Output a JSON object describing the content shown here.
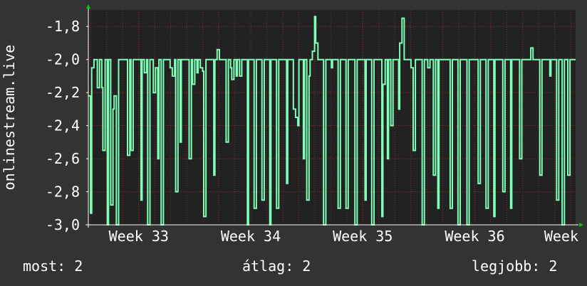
{
  "chart_data": {
    "type": "line",
    "ylabel": "onlinestream.live",
    "ylim": [
      -3.0,
      -1.7
    ],
    "yticks": [
      -3.0,
      -2.8,
      -2.6,
      -2.4,
      -2.2,
      -2.0,
      -1.8
    ],
    "ytick_labels": [
      "-3,0",
      "-2,8",
      "-2,6",
      "-2,4",
      "-2,2",
      "-2,0",
      "-1,8"
    ],
    "xlim": [
      32.55,
      36.9
    ],
    "xticks": [
      33,
      34,
      35,
      36,
      37
    ],
    "xtick_labels": [
      "Week 33",
      "Week 34",
      "Week 35",
      "Week 36",
      "Week"
    ],
    "grid": true,
    "colors": {
      "background": "#333333",
      "plot": "#222222",
      "grid": "#8b2a2a",
      "line": "#7effb7",
      "axis": "#ffffff",
      "arrow": "#00cc00"
    },
    "series": [
      {
        "values": [
          [
            32.55,
            -2.22
          ],
          [
            32.57,
            -2.93
          ],
          [
            32.58,
            -2.05
          ],
          [
            32.6,
            -2.0
          ],
          [
            32.62,
            -2.0
          ],
          [
            32.63,
            -2.17
          ],
          [
            32.65,
            -2.0
          ],
          [
            32.67,
            -2.17
          ],
          [
            32.68,
            -2.55
          ],
          [
            32.7,
            -2.0
          ],
          [
            32.72,
            -3.0
          ],
          [
            32.73,
            -2.0
          ],
          [
            32.75,
            -2.88
          ],
          [
            32.77,
            -2.3
          ],
          [
            32.78,
            -2.22
          ],
          [
            32.8,
            -3.0
          ],
          [
            32.82,
            -2.0
          ],
          [
            32.83,
            -2.0
          ],
          [
            32.85,
            -2.0
          ],
          [
            32.87,
            -2.0
          ],
          [
            32.88,
            -2.0
          ],
          [
            32.9,
            -2.58
          ],
          [
            32.92,
            -2.0
          ],
          [
            32.93,
            -2.55
          ],
          [
            32.95,
            -2.0
          ],
          [
            32.97,
            -2.0
          ],
          [
            32.98,
            -2.0
          ],
          [
            33.0,
            -2.0
          ],
          [
            33.02,
            -2.85
          ],
          [
            33.03,
            -2.0
          ],
          [
            33.05,
            -2.08
          ],
          [
            33.07,
            -2.0
          ],
          [
            33.08,
            -3.0
          ],
          [
            33.1,
            -2.0
          ],
          [
            33.12,
            -2.0
          ],
          [
            33.13,
            -2.2
          ],
          [
            33.15,
            -2.05
          ],
          [
            33.17,
            -2.6
          ],
          [
            33.18,
            -2.0
          ],
          [
            33.2,
            -3.0
          ],
          [
            33.22,
            -2.0
          ],
          [
            33.23,
            -2.0
          ],
          [
            33.25,
            -2.0
          ],
          [
            33.27,
            -2.0
          ],
          [
            33.28,
            -2.05
          ],
          [
            33.3,
            -2.1
          ],
          [
            33.32,
            -2.0
          ],
          [
            33.33,
            -2.8
          ],
          [
            33.35,
            -2.0
          ],
          [
            33.37,
            -2.5
          ],
          [
            33.38,
            -2.0
          ],
          [
            33.4,
            -2.0
          ],
          [
            33.42,
            -2.0
          ],
          [
            33.43,
            -2.0
          ],
          [
            33.45,
            -2.6
          ],
          [
            33.47,
            -2.0
          ],
          [
            33.48,
            -2.15
          ],
          [
            33.5,
            -2.0
          ],
          [
            33.52,
            -2.08
          ],
          [
            33.53,
            -2.0
          ],
          [
            33.55,
            -2.05
          ],
          [
            33.57,
            -2.07
          ],
          [
            33.58,
            -2.95
          ],
          [
            33.6,
            -2.0
          ],
          [
            33.62,
            -2.0
          ],
          [
            33.63,
            -2.0
          ],
          [
            33.65,
            -2.0
          ],
          [
            33.67,
            -2.7
          ],
          [
            33.68,
            -2.0
          ],
          [
            33.7,
            -1.94
          ],
          [
            33.72,
            -2.0
          ],
          [
            33.73,
            -2.0
          ],
          [
            33.75,
            -2.0
          ],
          [
            33.77,
            -2.0
          ],
          [
            33.78,
            -2.5
          ],
          [
            33.8,
            -2.0
          ],
          [
            33.82,
            -2.05
          ],
          [
            33.83,
            -2.12
          ],
          [
            33.85,
            -2.0
          ],
          [
            33.87,
            -2.1
          ],
          [
            33.88,
            -2.0
          ],
          [
            33.9,
            -2.1
          ],
          [
            33.92,
            -2.0
          ],
          [
            33.93,
            -2.0
          ],
          [
            33.95,
            -2.0
          ],
          [
            33.97,
            -3.0
          ],
          [
            33.98,
            -2.0
          ],
          [
            34.0,
            -2.0
          ],
          [
            34.02,
            -2.0
          ],
          [
            34.03,
            -2.9
          ],
          [
            34.05,
            -2.0
          ],
          [
            34.07,
            -2.0
          ],
          [
            34.08,
            -2.0
          ],
          [
            34.1,
            -2.85
          ],
          [
            34.12,
            -2.0
          ],
          [
            34.13,
            -2.0
          ],
          [
            34.15,
            -2.0
          ],
          [
            34.17,
            -3.0
          ],
          [
            34.18,
            -2.0
          ],
          [
            34.2,
            -2.0
          ],
          [
            34.22,
            -2.0
          ],
          [
            34.23,
            -2.9
          ],
          [
            34.25,
            -2.0
          ],
          [
            34.27,
            -2.0
          ],
          [
            34.28,
            -2.0
          ],
          [
            34.3,
            -2.0
          ],
          [
            34.32,
            -2.75
          ],
          [
            34.33,
            -2.0
          ],
          [
            34.35,
            -2.0
          ],
          [
            34.37,
            -2.0
          ],
          [
            34.38,
            -2.3
          ],
          [
            34.4,
            -2.35
          ],
          [
            34.42,
            -2.4
          ],
          [
            34.43,
            -2.0
          ],
          [
            34.45,
            -2.0
          ],
          [
            34.47,
            -2.6
          ],
          [
            34.48,
            -2.0
          ],
          [
            34.5,
            -2.85
          ],
          [
            34.52,
            -2.1
          ],
          [
            34.53,
            -2.0
          ],
          [
            34.55,
            -1.95
          ],
          [
            34.57,
            -1.74
          ],
          [
            34.58,
            -1.9
          ],
          [
            34.6,
            -2.0
          ],
          [
            34.62,
            -2.0
          ],
          [
            34.63,
            -2.0
          ],
          [
            34.65,
            -3.0
          ],
          [
            34.67,
            -2.0
          ],
          [
            34.68,
            -2.0
          ],
          [
            34.7,
            -2.0
          ],
          [
            34.72,
            -2.05
          ],
          [
            34.73,
            -2.0
          ],
          [
            34.75,
            -2.0
          ],
          [
            34.77,
            -2.0
          ],
          [
            34.78,
            -2.9
          ],
          [
            34.8,
            -2.0
          ],
          [
            34.82,
            -2.0
          ],
          [
            34.83,
            -2.0
          ],
          [
            34.85,
            -2.9
          ],
          [
            34.87,
            -2.0
          ],
          [
            34.88,
            -2.0
          ],
          [
            34.9,
            -2.0
          ],
          [
            34.92,
            -2.0
          ],
          [
            34.93,
            -3.0
          ],
          [
            34.95,
            -2.0
          ],
          [
            34.97,
            -2.0
          ],
          [
            34.98,
            -2.0
          ],
          [
            35.0,
            -2.0
          ],
          [
            35.02,
            -2.85
          ],
          [
            35.03,
            -2.0
          ],
          [
            35.05,
            -2.0
          ],
          [
            35.07,
            -2.0
          ],
          [
            35.08,
            -3.0
          ],
          [
            35.1,
            -2.0
          ],
          [
            35.12,
            -2.0
          ],
          [
            35.13,
            -2.0
          ],
          [
            35.15,
            -2.0
          ],
          [
            35.17,
            -2.95
          ],
          [
            35.18,
            -2.15
          ],
          [
            35.2,
            -2.0
          ],
          [
            35.22,
            -2.6
          ],
          [
            35.23,
            -2.0
          ],
          [
            35.25,
            -2.4
          ],
          [
            35.27,
            -2.0
          ],
          [
            35.28,
            -2.0
          ],
          [
            35.3,
            -2.0
          ],
          [
            35.32,
            -2.3
          ],
          [
            35.33,
            -1.9
          ],
          [
            35.35,
            -1.75
          ],
          [
            35.37,
            -2.0
          ],
          [
            35.38,
            -2.0
          ],
          [
            35.4,
            -2.0
          ],
          [
            35.42,
            -2.0
          ],
          [
            35.43,
            -2.05
          ],
          [
            35.45,
            -2.55
          ],
          [
            35.47,
            -2.0
          ],
          [
            35.48,
            -2.0
          ],
          [
            35.5,
            -2.0
          ],
          [
            35.52,
            -2.0
          ],
          [
            35.53,
            -3.0
          ],
          [
            35.55,
            -2.0
          ],
          [
            35.57,
            -2.0
          ],
          [
            35.58,
            -2.05
          ],
          [
            35.6,
            -2.0
          ],
          [
            35.62,
            -2.0
          ],
          [
            35.63,
            -2.7
          ],
          [
            35.65,
            -2.0
          ],
          [
            35.67,
            -2.9
          ],
          [
            35.68,
            -2.0
          ],
          [
            35.7,
            -2.0
          ],
          [
            35.72,
            -2.0
          ],
          [
            35.73,
            -2.0
          ],
          [
            35.75,
            -2.0
          ],
          [
            35.77,
            -2.0
          ],
          [
            35.78,
            -2.9
          ],
          [
            35.8,
            -2.0
          ],
          [
            35.82,
            -2.0
          ],
          [
            35.83,
            -2.0
          ],
          [
            35.85,
            -3.0
          ],
          [
            35.87,
            -2.0
          ],
          [
            35.88,
            -2.0
          ],
          [
            35.9,
            -2.0
          ],
          [
            35.92,
            -2.0
          ],
          [
            35.93,
            -3.0
          ],
          [
            35.95,
            -2.0
          ],
          [
            35.97,
            -2.0
          ],
          [
            35.98,
            -2.0
          ],
          [
            36.0,
            -2.0
          ],
          [
            36.02,
            -2.0
          ],
          [
            36.03,
            -2.75
          ],
          [
            36.05,
            -2.0
          ],
          [
            36.07,
            -2.0
          ],
          [
            36.08,
            -2.0
          ],
          [
            36.1,
            -2.9
          ],
          [
            36.12,
            -2.0
          ],
          [
            36.13,
            -2.0
          ],
          [
            36.15,
            -2.0
          ],
          [
            36.17,
            -2.95
          ],
          [
            36.18,
            -2.0
          ],
          [
            36.2,
            -2.0
          ],
          [
            36.22,
            -2.0
          ],
          [
            36.23,
            -2.0
          ],
          [
            36.25,
            -2.8
          ],
          [
            36.27,
            -2.0
          ],
          [
            36.28,
            -2.0
          ],
          [
            36.3,
            -2.0
          ],
          [
            36.32,
            -2.9
          ],
          [
            36.33,
            -2.0
          ],
          [
            36.35,
            -2.0
          ],
          [
            36.37,
            -2.0
          ],
          [
            36.38,
            -2.0
          ],
          [
            36.4,
            -2.6
          ],
          [
            36.42,
            -2.0
          ],
          [
            36.43,
            -2.0
          ],
          [
            36.45,
            -2.0
          ],
          [
            36.47,
            -2.0
          ],
          [
            36.48,
            -2.0
          ],
          [
            36.5,
            -1.93
          ],
          [
            36.52,
            -2.0
          ],
          [
            36.53,
            -2.0
          ],
          [
            36.55,
            -2.0
          ],
          [
            36.57,
            -2.0
          ],
          [
            36.58,
            -2.7
          ],
          [
            36.6,
            -2.0
          ],
          [
            36.62,
            -2.0
          ],
          [
            36.63,
            -2.0
          ],
          [
            36.65,
            -2.0
          ],
          [
            36.67,
            -2.1
          ],
          [
            36.68,
            -2.0
          ],
          [
            36.7,
            -2.0
          ],
          [
            36.72,
            -2.0
          ],
          [
            36.73,
            -2.85
          ],
          [
            36.75,
            -2.0
          ],
          [
            36.77,
            -2.0
          ],
          [
            36.78,
            -3.0
          ],
          [
            36.8,
            -2.0
          ],
          [
            36.82,
            -2.0
          ],
          [
            36.83,
            -2.7
          ],
          [
            36.85,
            -2.0
          ],
          [
            36.87,
            -2.0
          ],
          [
            36.88,
            -2.0
          ],
          [
            36.9,
            -2.0
          ]
        ]
      }
    ]
  },
  "stats": {
    "now": "most: 2",
    "avg": "átlag: 2",
    "max": "legjobb: 2"
  }
}
